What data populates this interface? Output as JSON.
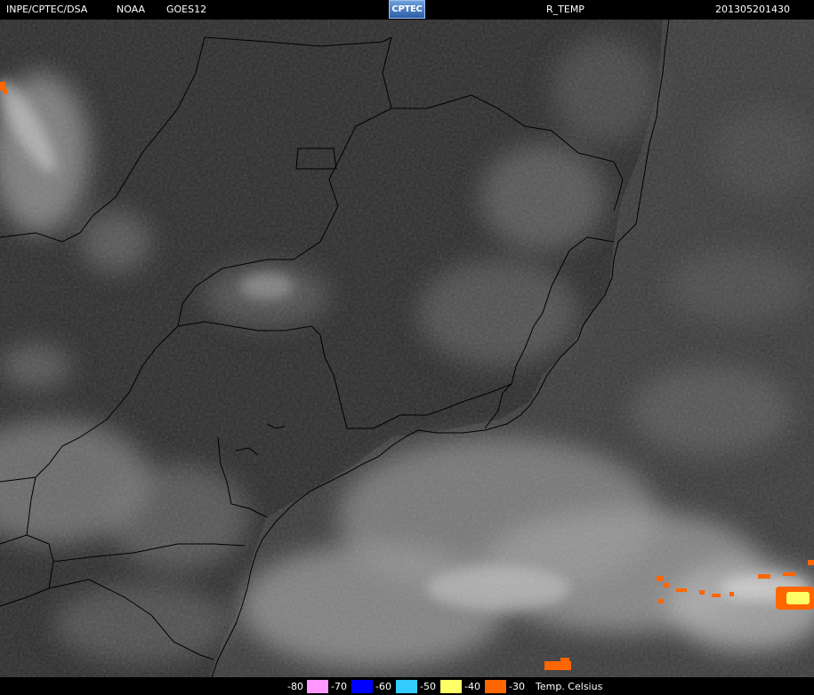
{
  "header": {
    "agency": "INPE/CPTEC/DSA",
    "provider": "NOAA",
    "satellite": "GOES12",
    "logo_text": "CPTEC",
    "product": "R_TEMP",
    "timestamp": "201305201430"
  },
  "legend": {
    "items": [
      {
        "label": "-80",
        "color": "#000000",
        "text_color": "#ffffff"
      },
      {
        "label": "-70",
        "color": "#ff99ff",
        "text_color": "#000000"
      },
      {
        "label": "-60",
        "color": "#0000ff",
        "text_color": "#000000"
      },
      {
        "label": "-50",
        "color": "#33ccff",
        "text_color": "#000000"
      },
      {
        "label": "-40",
        "color": "#ffff66",
        "text_color": "#000000"
      },
      {
        "label": "-30",
        "color": "#ff6600",
        "text_color": "#000000"
      }
    ],
    "caption": "Temp. Celsius"
  },
  "colors": {
    "background": "#000000",
    "land_dark": "#2e2e2e",
    "ocean": "#3d3d3d",
    "cloud_light": "#bdbdbd",
    "borders": "#000000",
    "cold_top_orange": "#ff6600",
    "cold_top_yellow": "#ffff66"
  }
}
